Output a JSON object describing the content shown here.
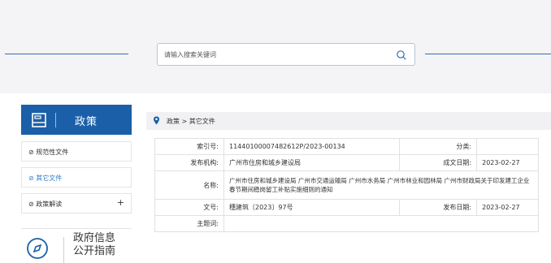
{
  "search": {
    "placeholder": "请输入搜索关键词"
  },
  "sidebar": {
    "title": "政策",
    "items": [
      {
        "label": "规范性文件",
        "active": false
      },
      {
        "label": "其它文件",
        "active": true
      },
      {
        "label": "政策解读",
        "active": false,
        "expand": "+"
      }
    ],
    "gov_info": {
      "line1": "政府信息",
      "line2": "公开指南"
    }
  },
  "breadcrumb": {
    "text": "政策 > 其它文件"
  },
  "info": {
    "index_label": "索引号:",
    "index_value": "11440100007482612P/2023-00134",
    "category_label": "分类:",
    "category_value": "",
    "issuer_label": "发布机构:",
    "issuer_value": "广州市住房和城乡建设局",
    "created_label": "成文日期:",
    "created_value": "2023-02-27",
    "name_label": "名称:",
    "name_value": "广州市住房和城乡建设局 广州市交通运输局 广州市水务局 广州市林业和园林局 广州市财政局关于印发建工企业春节期间稳岗留工补贴实施细则的通知",
    "docno_label": "文号:",
    "docno_value": "穗建筑〔2023〕97号",
    "published_label": "发布日期:",
    "published_value": "2023-02-27",
    "subject_label": "主题词:",
    "subject_value": ""
  },
  "colors": {
    "brand": "#1a5fa8",
    "accent_line": "#2e6fb3",
    "active_link": "#2f7fd0"
  }
}
